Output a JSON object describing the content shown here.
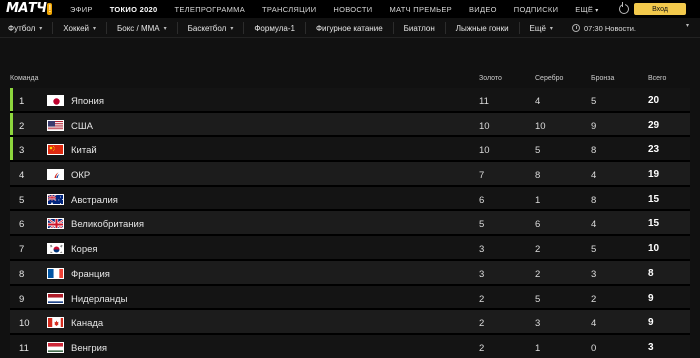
{
  "header": {
    "logo": "МАТЧ",
    "logo_mark": "!",
    "nav": [
      {
        "label": "ЭФИР"
      },
      {
        "label": "ТОКИО 2020",
        "active": true
      },
      {
        "label": "ТЕЛЕПРОГРАММА"
      },
      {
        "label": "ТРАНСЛЯЦИИ"
      },
      {
        "label": "НОВОСТИ"
      },
      {
        "label": "МАТЧ ПРЕМЬЕР"
      },
      {
        "label": "ВИДЕО"
      },
      {
        "label": "ПОДПИСКИ"
      },
      {
        "label": "ЕЩЁ"
      }
    ],
    "login_label": "Вход",
    "accent_color": "#f2c94c"
  },
  "sports": {
    "items": [
      "Футбол",
      "Хоккей",
      "Бокс / ММА",
      "Баскетбол",
      "Формула-1",
      "Фигурное катание",
      "Биатлон",
      "Лыжные гонки",
      "Ещё"
    ],
    "ticker": "07:30 Новости."
  },
  "table": {
    "headers": {
      "team": "Команда",
      "gold": "Золото",
      "silver": "Серебро",
      "bronze": "Бронза",
      "total": "Всего"
    },
    "highlight_color": "#8dd63d",
    "rows": [
      {
        "rank": "1",
        "name": "Япония",
        "flag": "japan-flag-icon",
        "gold": "11",
        "silver": "4",
        "bronze": "5",
        "total": "20"
      },
      {
        "rank": "2",
        "name": "США",
        "flag": "usa-flag-icon",
        "gold": "10",
        "silver": "10",
        "bronze": "9",
        "total": "29"
      },
      {
        "rank": "3",
        "name": "Китай",
        "flag": "china-flag-icon",
        "gold": "10",
        "silver": "5",
        "bronze": "8",
        "total": "23"
      },
      {
        "rank": "4",
        "name": "ОКР",
        "flag": "roc-flag-icon",
        "gold": "7",
        "silver": "8",
        "bronze": "4",
        "total": "19"
      },
      {
        "rank": "5",
        "name": "Австралия",
        "flag": "australia-flag-icon",
        "gold": "6",
        "silver": "1",
        "bronze": "8",
        "total": "15"
      },
      {
        "rank": "6",
        "name": "Великобритания",
        "flag": "uk-flag-icon",
        "gold": "5",
        "silver": "6",
        "bronze": "4",
        "total": "15"
      },
      {
        "rank": "7",
        "name": "Корея",
        "flag": "korea-flag-icon",
        "gold": "3",
        "silver": "2",
        "bronze": "5",
        "total": "10"
      },
      {
        "rank": "8",
        "name": "Франция",
        "flag": "france-flag-icon",
        "gold": "3",
        "silver": "2",
        "bronze": "3",
        "total": "8"
      },
      {
        "rank": "9",
        "name": "Нидерланды",
        "flag": "netherlands-flag-icon",
        "gold": "2",
        "silver": "5",
        "bronze": "2",
        "total": "9"
      },
      {
        "rank": "10",
        "name": "Канада",
        "flag": "canada-flag-icon",
        "gold": "2",
        "silver": "3",
        "bronze": "4",
        "total": "9"
      },
      {
        "rank": "11",
        "name": "Венгрия",
        "flag": "hungary-flag-icon",
        "gold": "2",
        "silver": "1",
        "bronze": "0",
        "total": "3"
      }
    ]
  }
}
